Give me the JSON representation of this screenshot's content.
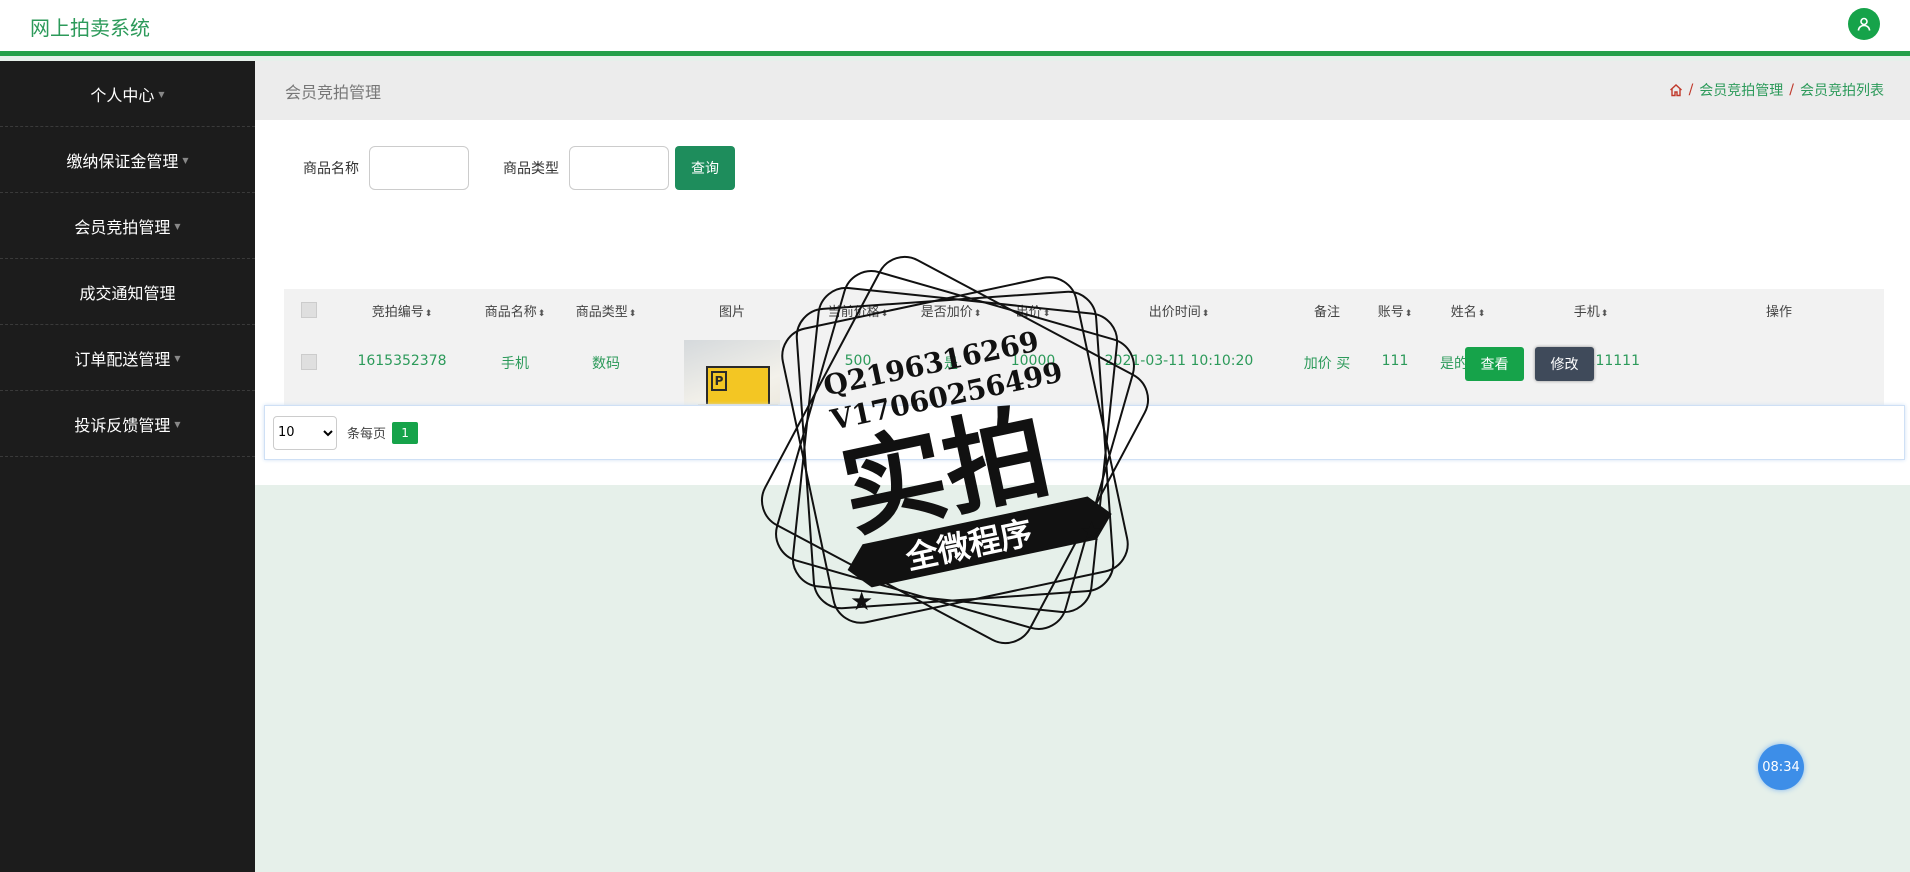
{
  "app": {
    "title": "网上拍卖系统"
  },
  "sidebar": {
    "items": [
      {
        "label": "个人中心"
      },
      {
        "label": "缴纳保证金管理"
      },
      {
        "label": "会员竞拍管理"
      },
      {
        "label": "成交通知管理"
      },
      {
        "label": "订单配送管理"
      },
      {
        "label": "投诉反馈管理"
      }
    ]
  },
  "page": {
    "title": "会员竞拍管理",
    "breadcrumb": [
      "会员竞拍管理",
      "会员竞拍列表"
    ],
    "breadcrumb_sep": "/"
  },
  "search": {
    "name_label": "商品名称",
    "type_label": "商品类型",
    "name_value": "",
    "type_value": "",
    "query_button": "查询"
  },
  "table": {
    "columns": [
      "竞拍编号",
      "商品名称",
      "商品类型",
      "图片",
      "当前价格",
      "是否加价",
      "出价",
      "出价时间",
      "备注",
      "账号",
      "姓名",
      "手机",
      "操作"
    ],
    "rows": [
      {
        "id": "1615352378",
        "name": "手机",
        "type": "数码",
        "current_price": "500",
        "raise": "是",
        "bid": "10000",
        "bid_time": "2021-03-11 10:10:20",
        "note": "加价 买",
        "account": "111",
        "realname": "是的方法",
        "phone": "11111111111",
        "view": "查看",
        "edit": "修改"
      }
    ]
  },
  "pager": {
    "page_size": "10",
    "per_page_label": "条每页",
    "current_page": "1"
  },
  "clock": {
    "time": "08:34"
  },
  "watermark": {
    "line1": "Q2196316269",
    "line2": "V17060256499",
    "big": "实拍",
    "banner": "全微程序"
  },
  "colors": {
    "accent": "#16a34a",
    "sidebar_bg": "#1c1c1c",
    "link": "#2c9a5a",
    "edit_btn": "#3f4a5a"
  },
  "icons": {
    "user": "user-icon",
    "home": "home-icon",
    "sort": "sort-icon"
  }
}
